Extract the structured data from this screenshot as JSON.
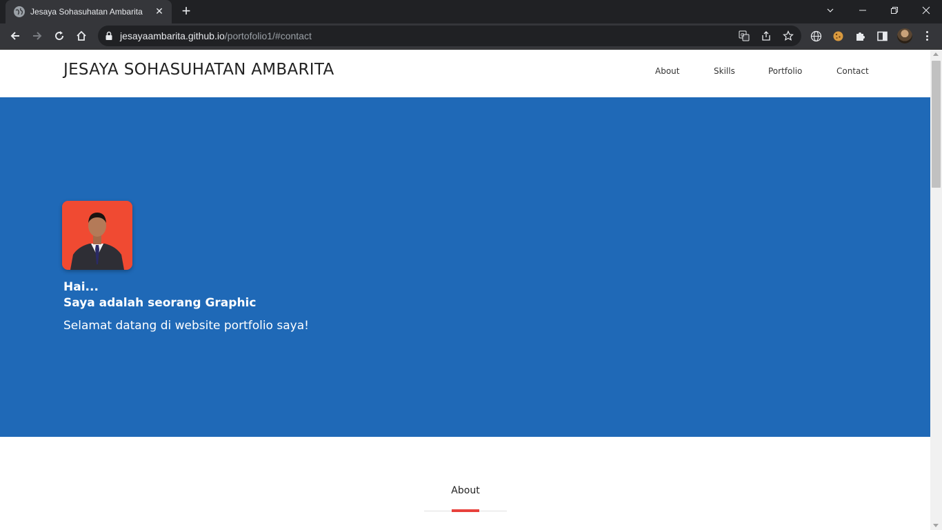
{
  "browser": {
    "tab_title": "Jesaya Sohasuhatan Ambarita",
    "url_host": "jesayaambarita.github.io",
    "url_path": "/portofolio1/#contact"
  },
  "site": {
    "brand": "JESAYA SOHASUHATAN AMBARITA",
    "nav": [
      {
        "label": "About"
      },
      {
        "label": "Skills"
      },
      {
        "label": "Portfolio"
      },
      {
        "label": "Contact"
      }
    ],
    "hero": {
      "greeting": "Hai...",
      "role": "Saya adalah seorang Graphic",
      "welcome": "Selamat datang di website portfolio saya!"
    },
    "about": {
      "title": "About"
    }
  },
  "colors": {
    "hero_bg": "#1f69b7",
    "accent": "#e8413c",
    "avatar_bg": "#f04a32"
  }
}
